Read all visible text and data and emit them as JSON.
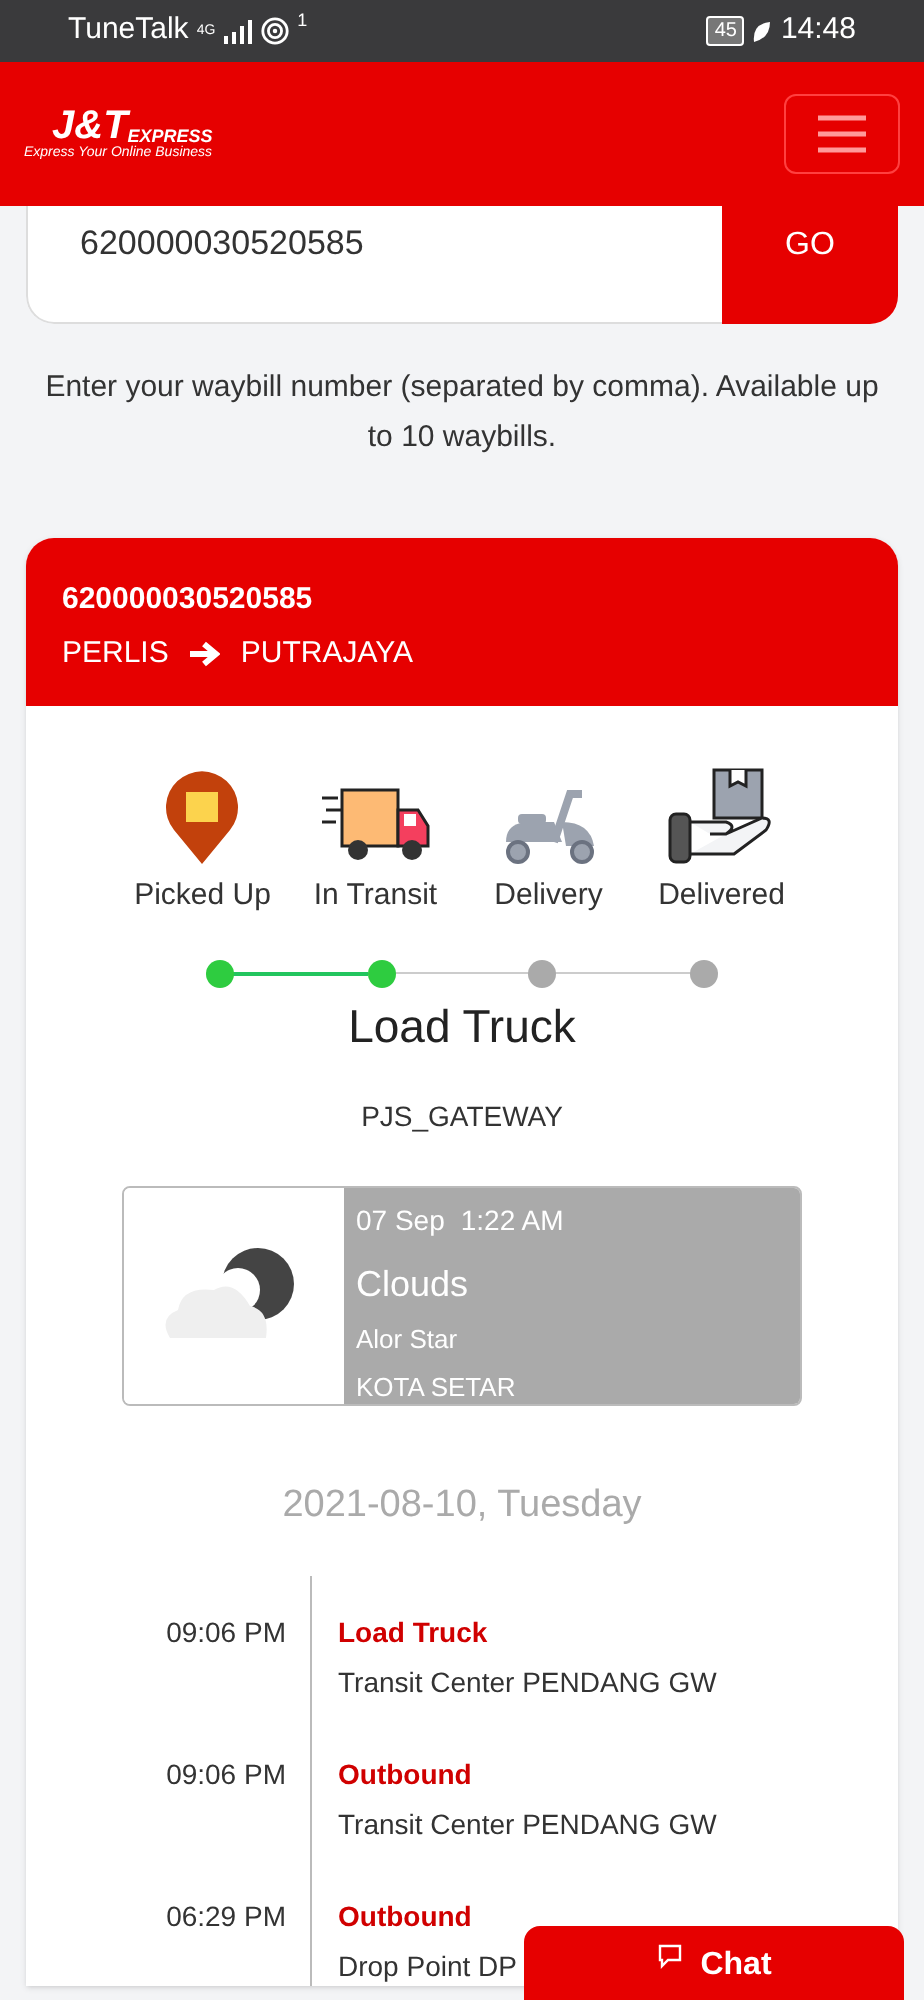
{
  "status_bar": {
    "carrier": "TuneTalk",
    "network": "4G",
    "hotspot_count": "1",
    "battery": "45",
    "time": "14:48"
  },
  "header": {
    "logo_mark": "J&T",
    "logo_word": "EXPRESS",
    "tagline": "Express Your Online Business"
  },
  "search": {
    "value": "620000030520585",
    "button": "GO",
    "hint": "Enter your waybill number (separated by comma). Available up to 10 waybills."
  },
  "shipment": {
    "waybill": "620000030520585",
    "origin": "PERLIS",
    "destination": "PUTRAJAYA",
    "stages": [
      {
        "kind": "pin",
        "label": "Picked Up",
        "done": true
      },
      {
        "kind": "truck",
        "label": "In Transit",
        "done": true
      },
      {
        "kind": "scooter",
        "label": "Delivery",
        "done": false
      },
      {
        "kind": "hand",
        "label": "Delivered",
        "done": false
      }
    ],
    "current_status": "Load Truck",
    "current_place": "PJS_GATEWAY",
    "weather": {
      "date": "07 Sep",
      "time": "1:22 AM",
      "condition": "Clouds",
      "city": "Alor Star",
      "area": "KOTA SETAR"
    },
    "date_heading": "2021-08-10, Tuesday",
    "events": [
      {
        "time": "09:06 PM",
        "status": "Load Truck",
        "place": "Transit Center PENDANG GW"
      },
      {
        "time": "09:06 PM",
        "status": "Outbound",
        "place": "Transit Center PENDANG GW"
      },
      {
        "time": "06:29 PM",
        "status": "Outbound",
        "place": "Drop Point DP"
      }
    ]
  },
  "chat_button": "Chat"
}
